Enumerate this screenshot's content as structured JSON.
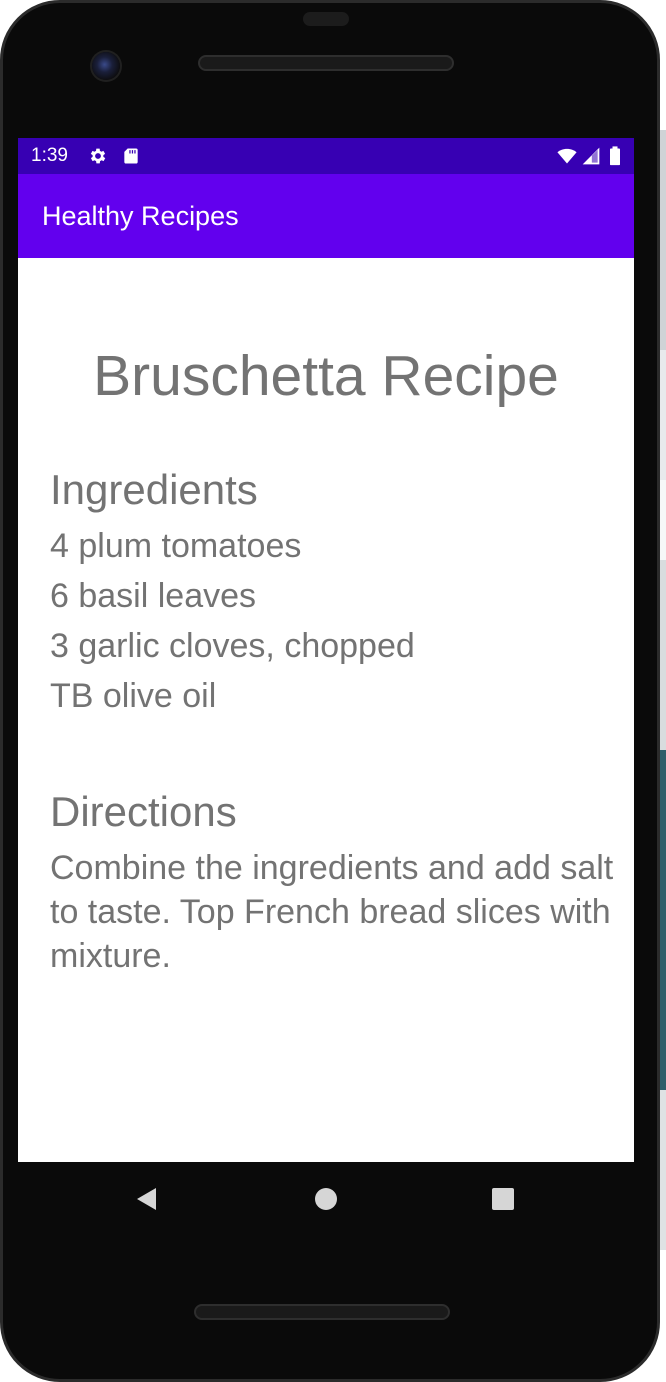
{
  "status_bar": {
    "time": "1:39",
    "icons": [
      "gear-icon",
      "sd-card-icon",
      "wifi-icon",
      "cellular-signal-icon",
      "battery-icon"
    ]
  },
  "app_bar": {
    "title": "Healthy Recipes",
    "color": "#6200ee",
    "status_color": "#3700b3"
  },
  "recipe": {
    "title": "Bruschetta Recipe",
    "ingredients_heading": "Ingredients",
    "ingredients": [
      "4 plum tomatoes",
      "6 basil leaves",
      "3 garlic cloves, chopped",
      "TB olive oil"
    ],
    "directions_heading": "Directions",
    "directions": "Combine the ingredients and add salt to taste. Top French bread slices with mixture."
  },
  "nav_bar": {
    "icons": [
      "back-icon",
      "home-icon",
      "recents-icon"
    ]
  }
}
